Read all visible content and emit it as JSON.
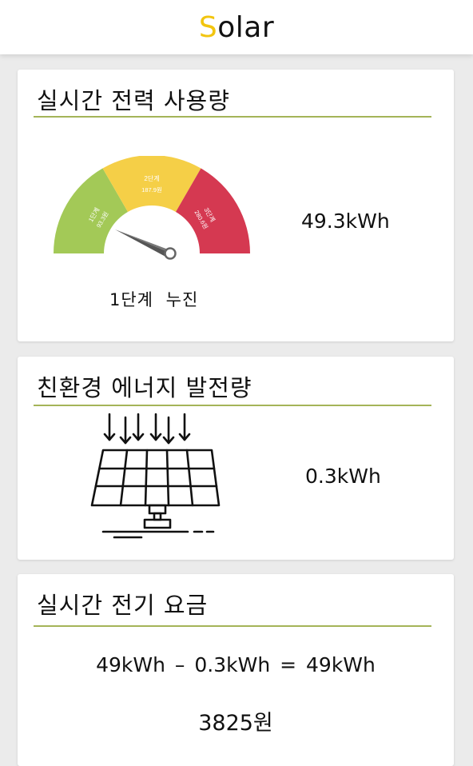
{
  "header": {
    "logo_first": "S",
    "logo_rest": "olar",
    "logo_accent": "#f2c50f"
  },
  "usage_card": {
    "title": "실시간 전력 사용량",
    "value": "49.3kWh",
    "gauge_caption": "1단계  누진",
    "gauge_level": 1,
    "gauge": {
      "segments": [
        {
          "label": "1단계",
          "sub": "93.3원",
          "color": "#a3c957"
        },
        {
          "label": "2단계",
          "sub": "187.9원",
          "color": "#f5cf47"
        },
        {
          "label": "3단계",
          "sub": "280.6원",
          "color": "#d53951"
        }
      ]
    }
  },
  "generation_card": {
    "title": "친환경 에너지 발전량",
    "value": "0.3kWh",
    "icon": "solar-panel-icon"
  },
  "fee_card": {
    "title": "실시간 전기 요금",
    "equation": "49kWh – 0.3kWh = 49kWh",
    "fee": "3825원"
  },
  "colors": {
    "rule": "#a4b458",
    "background": "#ebebeb"
  }
}
